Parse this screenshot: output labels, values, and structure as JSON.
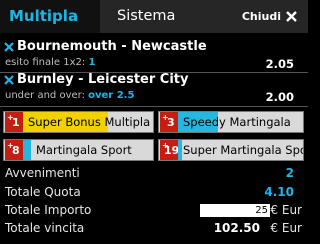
{
  "tabs": {
    "active": "Multipla",
    "other": "Sistema",
    "close_label": "Chiudi"
  },
  "selections": [
    {
      "match": "Bournemouth - Newcastle",
      "market": "esito finale 1x2:",
      "outcome": "1",
      "odds": "2.05"
    },
    {
      "match": "Burnley - Leicester City",
      "market": "under and over:",
      "outcome": "over 2.5",
      "odds": "2.00"
    }
  ],
  "bonus_buttons": [
    {
      "badge_prefix": "+",
      "badge_num": "1",
      "label": "Super Bonus Multipla",
      "bar_color": "#f2d100"
    },
    {
      "badge_prefix": "+",
      "badge_num": "3",
      "label": "Speedy Martingala",
      "bar_color": "#25b7e0"
    },
    {
      "badge_prefix": "+",
      "badge_num": "8",
      "label": "Martingala Sport",
      "bar_color": "#25b7e0"
    },
    {
      "badge_prefix": "+",
      "badge_num": "19",
      "label": "Super Martingala Sport",
      "bar_color": "#25b7e0"
    }
  ],
  "summary": {
    "events_label": "Avvenimenti",
    "events_value": "2",
    "odds_label": "Totale Quota",
    "odds_value": "4.10",
    "amount_label": "Totale Importo",
    "amount_value": "25",
    "amount_currency": "€ Eur",
    "win_label": "Totale vincita",
    "win_value": "102.50",
    "win_currency": "€ Eur"
  },
  "colors": {
    "accent": "#1cb6e6",
    "badge_red": "#c41d12"
  }
}
